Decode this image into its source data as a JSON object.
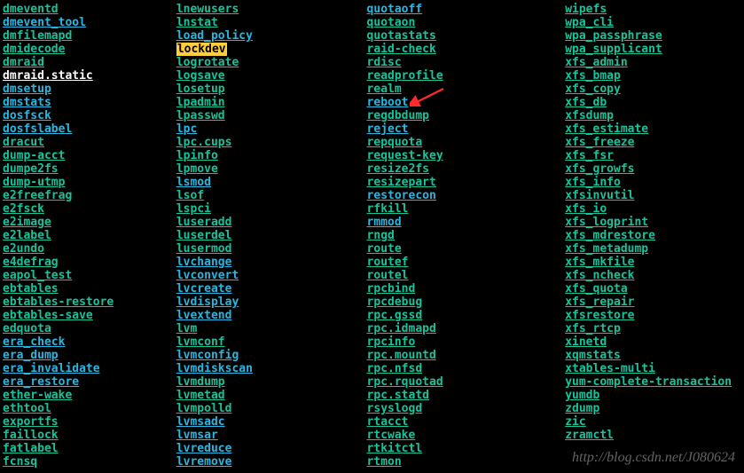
{
  "watermark": "http://blog.csdn.net/J080624",
  "arrow_target": "reboot",
  "columns": [
    [
      {
        "t": "dmeventd",
        "c": "cmd"
      },
      {
        "t": "dmevent_tool",
        "c": "alias"
      },
      {
        "t": "dmfilemapd",
        "c": "cmd"
      },
      {
        "t": "dmidecode",
        "c": "cmd"
      },
      {
        "t": "dmraid",
        "c": "cmd"
      },
      {
        "t": "dmraid.static",
        "c": "bold-white"
      },
      {
        "t": "dmsetup",
        "c": "alias"
      },
      {
        "t": "dmstats",
        "c": "alias"
      },
      {
        "t": "dosfsck",
        "c": "alias"
      },
      {
        "t": "dosfslabel",
        "c": "alias"
      },
      {
        "t": "dracut",
        "c": "cmd"
      },
      {
        "t": "dump-acct",
        "c": "cmd"
      },
      {
        "t": "dumpe2fs",
        "c": "cmd"
      },
      {
        "t": "dump-utmp",
        "c": "cmd"
      },
      {
        "t": "e2freefrag",
        "c": "cmd"
      },
      {
        "t": "e2fsck",
        "c": "cmd"
      },
      {
        "t": "e2image",
        "c": "cmd"
      },
      {
        "t": "e2label",
        "c": "cmd"
      },
      {
        "t": "e2undo",
        "c": "cmd"
      },
      {
        "t": "e4defrag",
        "c": "cmd"
      },
      {
        "t": "eapol_test",
        "c": "cmd"
      },
      {
        "t": "ebtables",
        "c": "cmd"
      },
      {
        "t": "ebtables-restore",
        "c": "cmd"
      },
      {
        "t": "ebtables-save",
        "c": "cmd"
      },
      {
        "t": "edquota",
        "c": "cmd"
      },
      {
        "t": "era_check",
        "c": "alias"
      },
      {
        "t": "era_dump",
        "c": "alias"
      },
      {
        "t": "era_invalidate",
        "c": "alias"
      },
      {
        "t": "era_restore",
        "c": "alias"
      },
      {
        "t": "ether-wake",
        "c": "cmd"
      },
      {
        "t": "ethtool",
        "c": "cmd"
      },
      {
        "t": "exportfs",
        "c": "cmd"
      },
      {
        "t": "faillock",
        "c": "cmd"
      },
      {
        "t": "fatlabel",
        "c": "cmd"
      },
      {
        "t": "fcnsq",
        "c": "cmd"
      }
    ],
    [
      {
        "t": "lnewusers",
        "c": "cmd"
      },
      {
        "t": "lnstat",
        "c": "cmd"
      },
      {
        "t": "load_policy",
        "c": "alias"
      },
      {
        "t": "lockdev",
        "c": "hl"
      },
      {
        "t": "logrotate",
        "c": "cmd"
      },
      {
        "t": "logsave",
        "c": "cmd"
      },
      {
        "t": "losetup",
        "c": "cmd"
      },
      {
        "t": "lpadmin",
        "c": "cmd"
      },
      {
        "t": "lpasswd",
        "c": "cmd"
      },
      {
        "t": "lpc",
        "c": "alias"
      },
      {
        "t": "lpc.cups",
        "c": "cmd"
      },
      {
        "t": "lpinfo",
        "c": "cmd"
      },
      {
        "t": "lpmove",
        "c": "cmd"
      },
      {
        "t": "lsmod",
        "c": "alias"
      },
      {
        "t": "lsof",
        "c": "cmd"
      },
      {
        "t": "lspci",
        "c": "cmd"
      },
      {
        "t": "luseradd",
        "c": "cmd"
      },
      {
        "t": "luserdel",
        "c": "cmd"
      },
      {
        "t": "lusermod",
        "c": "cmd"
      },
      {
        "t": "lvchange",
        "c": "alias"
      },
      {
        "t": "lvconvert",
        "c": "alias"
      },
      {
        "t": "lvcreate",
        "c": "alias"
      },
      {
        "t": "lvdisplay",
        "c": "alias"
      },
      {
        "t": "lvextend",
        "c": "alias"
      },
      {
        "t": "lvm",
        "c": "cmd"
      },
      {
        "t": "lvmconf",
        "c": "cmd"
      },
      {
        "t": "lvmconfig",
        "c": "alias"
      },
      {
        "t": "lvmdiskscan",
        "c": "alias"
      },
      {
        "t": "lvmdump",
        "c": "cmd"
      },
      {
        "t": "lvmetad",
        "c": "cmd"
      },
      {
        "t": "lvmpolld",
        "c": "cmd"
      },
      {
        "t": "lvmsadc",
        "c": "alias"
      },
      {
        "t": "lvmsar",
        "c": "alias"
      },
      {
        "t": "lvreduce",
        "c": "alias"
      },
      {
        "t": "lvremove",
        "c": "alias"
      }
    ],
    [
      {
        "t": "quotaoff",
        "c": "alias"
      },
      {
        "t": "quotaon",
        "c": "cmd"
      },
      {
        "t": "quotastats",
        "c": "cmd"
      },
      {
        "t": "raid-check",
        "c": "cmd"
      },
      {
        "t": "rdisc",
        "c": "cmd"
      },
      {
        "t": "readprofile",
        "c": "cmd"
      },
      {
        "t": "realm",
        "c": "cmd"
      },
      {
        "t": "reboot",
        "c": "alias"
      },
      {
        "t": "regdbdump",
        "c": "cmd"
      },
      {
        "t": "reject",
        "c": "alias"
      },
      {
        "t": "repquota",
        "c": "cmd"
      },
      {
        "t": "request-key",
        "c": "cmd"
      },
      {
        "t": "resize2fs",
        "c": "cmd"
      },
      {
        "t": "resizepart",
        "c": "cmd"
      },
      {
        "t": "restorecon",
        "c": "alias"
      },
      {
        "t": "rfkill",
        "c": "cmd"
      },
      {
        "t": "rmmod",
        "c": "alias"
      },
      {
        "t": "rngd",
        "c": "cmd"
      },
      {
        "t": "route",
        "c": "cmd"
      },
      {
        "t": "routef",
        "c": "cmd"
      },
      {
        "t": "routel",
        "c": "cmd"
      },
      {
        "t": "rpcbind",
        "c": "cmd"
      },
      {
        "t": "rpcdebug",
        "c": "cmd"
      },
      {
        "t": "rpc.gssd",
        "c": "cmd"
      },
      {
        "t": "rpc.idmapd",
        "c": "cmd"
      },
      {
        "t": "rpcinfo",
        "c": "cmd"
      },
      {
        "t": "rpc.mountd",
        "c": "cmd"
      },
      {
        "t": "rpc.nfsd",
        "c": "cmd"
      },
      {
        "t": "rpc.rquotad",
        "c": "cmd"
      },
      {
        "t": "rpc.statd",
        "c": "cmd"
      },
      {
        "t": "rsyslogd",
        "c": "cmd"
      },
      {
        "t": "rtacct",
        "c": "cmd"
      },
      {
        "t": "rtcwake",
        "c": "cmd"
      },
      {
        "t": "rtkitctl",
        "c": "cmd"
      },
      {
        "t": "rtmon",
        "c": "cmd"
      }
    ],
    [
      {
        "t": "wipefs",
        "c": "cmd"
      },
      {
        "t": "wpa_cli",
        "c": "cmd"
      },
      {
        "t": "wpa_passphrase",
        "c": "cmd"
      },
      {
        "t": "wpa_supplicant",
        "c": "cmd"
      },
      {
        "t": "xfs_admin",
        "c": "cmd"
      },
      {
        "t": "xfs_bmap",
        "c": "cmd"
      },
      {
        "t": "xfs_copy",
        "c": "cmd"
      },
      {
        "t": "xfs_db",
        "c": "cmd"
      },
      {
        "t": "xfsdump",
        "c": "cmd"
      },
      {
        "t": "xfs_estimate",
        "c": "cmd"
      },
      {
        "t": "xfs_freeze",
        "c": "cmd"
      },
      {
        "t": "xfs_fsr",
        "c": "cmd"
      },
      {
        "t": "xfs_growfs",
        "c": "cmd"
      },
      {
        "t": "xfs_info",
        "c": "cmd"
      },
      {
        "t": "xfsinvutil",
        "c": "cmd"
      },
      {
        "t": "xfs_io",
        "c": "cmd"
      },
      {
        "t": "xfs_logprint",
        "c": "cmd"
      },
      {
        "t": "xfs_mdrestore",
        "c": "cmd"
      },
      {
        "t": "xfs_metadump",
        "c": "cmd"
      },
      {
        "t": "xfs_mkfile",
        "c": "cmd"
      },
      {
        "t": "xfs_ncheck",
        "c": "cmd"
      },
      {
        "t": "xfs_quota",
        "c": "cmd"
      },
      {
        "t": "xfs_repair",
        "c": "cmd"
      },
      {
        "t": "xfsrestore",
        "c": "cmd"
      },
      {
        "t": "xfs_rtcp",
        "c": "cmd"
      },
      {
        "t": "xinetd",
        "c": "cmd"
      },
      {
        "t": "xqmstats",
        "c": "cmd"
      },
      {
        "t": "xtables-multi",
        "c": "cmd"
      },
      {
        "t": "yum-complete-transaction",
        "c": "cmd"
      },
      {
        "t": "yumdb",
        "c": "cmd"
      },
      {
        "t": "zdump",
        "c": "cmd"
      },
      {
        "t": "zic",
        "c": "cmd"
      },
      {
        "t": "zramctl",
        "c": "cmd"
      }
    ]
  ]
}
